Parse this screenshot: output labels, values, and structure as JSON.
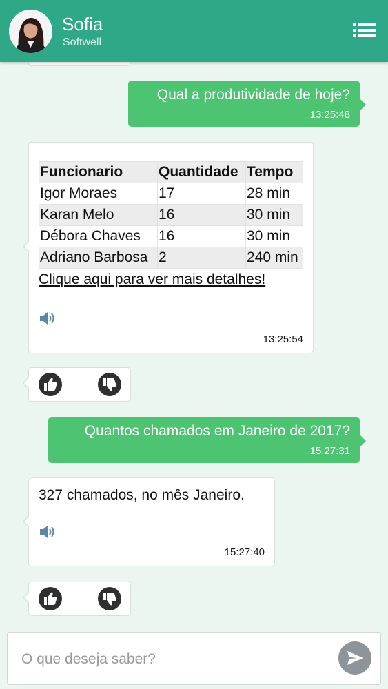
{
  "header": {
    "name": "Sofia",
    "company": "Softwell"
  },
  "messages": {
    "q1": {
      "text": "Qual a produtividade de hoje?",
      "time": "13:25:48"
    },
    "a1": {
      "columns": [
        "Funcionario",
        "Quantidade",
        "Tempo"
      ],
      "rows": [
        [
          "Igor Moraes",
          "17",
          "28 min"
        ],
        [
          "Karan Melo",
          "16",
          "30 min"
        ],
        [
          "Débora Chaves",
          "16",
          "30 min"
        ],
        [
          "Adriano Barbosa",
          "2",
          "240 min"
        ]
      ],
      "link": "Clique aqui para ver mais detalhes!",
      "time": "13:25:54"
    },
    "q2": {
      "text": "Quantos chamados em Janeiro de 2017?",
      "time": "15:27:31"
    },
    "a2": {
      "text": "327 chamados, no mês Janeiro.",
      "time": "15:27:40"
    }
  },
  "input": {
    "placeholder": "O que deseja saber?"
  },
  "icons": {
    "menu": "menu-icon",
    "speaker": "speaker-icon",
    "thumbs_up": "thumbs-up-icon",
    "thumbs_down": "thumbs-down-icon",
    "send": "send-icon"
  },
  "colors": {
    "header": "#2ea886",
    "user_bubble": "#4dc472",
    "background": "#eaf6ef",
    "bot_bubble": "#ffffff",
    "send_button": "#8e949a"
  }
}
